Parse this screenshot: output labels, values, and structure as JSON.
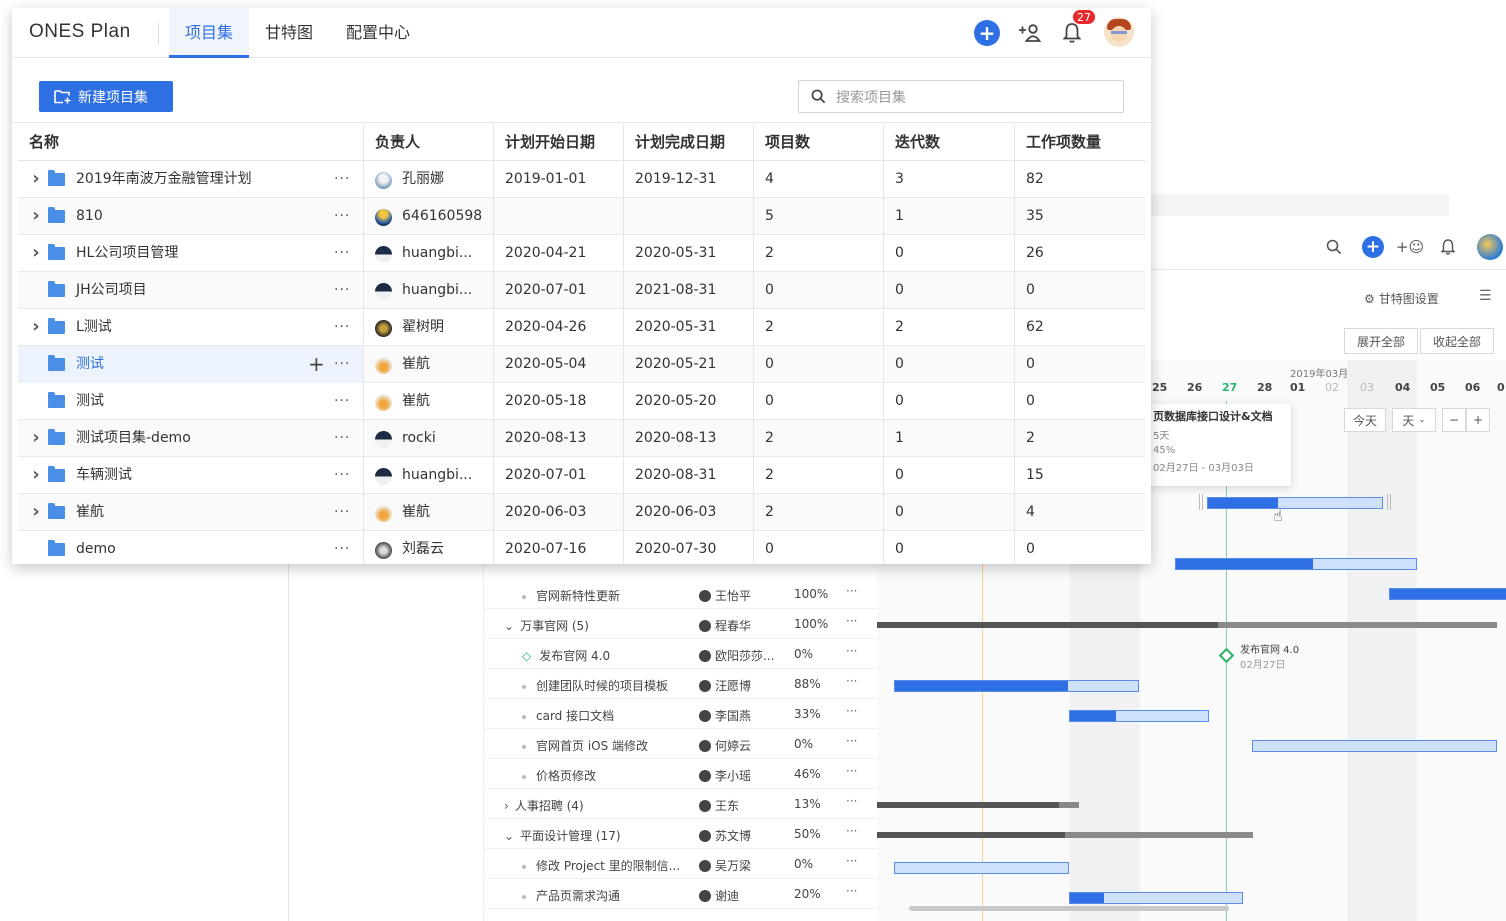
{
  "app": {
    "brand": "ONES Plan",
    "tabs": [
      {
        "label": "项目集",
        "active": true
      },
      {
        "label": "甘特图",
        "active": false
      },
      {
        "label": "配置中心",
        "active": false
      }
    ],
    "notification_count": "27",
    "accent_color": "#2f6fe4",
    "badge_color": "#e7292d"
  },
  "toolbar": {
    "new_button_label": "新建项目集",
    "search_placeholder": "搜索项目集"
  },
  "table": {
    "columns": [
      "名称",
      "负责人",
      "计划开始日期",
      "计划完成日期",
      "项目数",
      "迭代数",
      "工作项数量"
    ],
    "rows": [
      {
        "name": "2019年南波万金融管理计划",
        "owner": "孔丽娜",
        "start": "2019-01-01",
        "end": "2019-12-31",
        "projects": "4",
        "iterations": "3",
        "items": "82",
        "expandable": true
      },
      {
        "name": "810",
        "owner": "646160598",
        "start": "",
        "end": "",
        "projects": "5",
        "iterations": "1",
        "items": "35",
        "expandable": true
      },
      {
        "name": "HL公司项目管理",
        "owner": "huangbi...",
        "start": "2020-04-21",
        "end": "2020-05-31",
        "projects": "2",
        "iterations": "0",
        "items": "26",
        "expandable": true
      },
      {
        "name": "JH公司项目",
        "owner": "huangbi...",
        "start": "2020-07-01",
        "end": "2021-08-31",
        "projects": "0",
        "iterations": "0",
        "items": "0",
        "expandable": false
      },
      {
        "name": "L测试",
        "owner": "翟树明",
        "start": "2020-04-26",
        "end": "2020-05-31",
        "projects": "2",
        "iterations": "2",
        "items": "62",
        "expandable": true
      },
      {
        "name": "测试",
        "owner": "崔航",
        "start": "2020-05-04",
        "end": "2020-05-21",
        "projects": "0",
        "iterations": "0",
        "items": "0",
        "expandable": false,
        "selected": true
      },
      {
        "name": "测试",
        "owner": "崔航",
        "start": "2020-05-18",
        "end": "2020-05-20",
        "projects": "0",
        "iterations": "0",
        "items": "0",
        "expandable": false
      },
      {
        "name": "测试项目集-demo",
        "owner": "rocki",
        "start": "2020-08-13",
        "end": "2020-08-13",
        "projects": "2",
        "iterations": "1",
        "items": "2",
        "expandable": true
      },
      {
        "name": "车辆测试",
        "owner": "huangbi...",
        "start": "2020-07-01",
        "end": "2020-08-31",
        "projects": "2",
        "iterations": "0",
        "items": "15",
        "expandable": true
      },
      {
        "name": "崔航",
        "owner": "崔航",
        "start": "2020-06-03",
        "end": "2020-06-03",
        "projects": "2",
        "iterations": "0",
        "items": "4",
        "expandable": true
      },
      {
        "name": "demo",
        "owner": "刘磊云",
        "start": "2020-07-16",
        "end": "2020-07-30",
        "projects": "0",
        "iterations": "0",
        "items": "0",
        "expandable": false
      }
    ]
  },
  "background_gantt": {
    "gantt_settings_label": "甘特图设置",
    "expand_all_label": "展开全部",
    "collapse_all_label": "收起全部",
    "today_label": "今天",
    "unit_label": "天",
    "month_label": "2019年03月",
    "days": [
      "25",
      "26",
      "27",
      "28",
      "01",
      "02",
      "03",
      "04",
      "05",
      "06",
      "0"
    ],
    "tooltip": {
      "title": "页数据库接口设计&文档",
      "duration": "5天",
      "progress": "45%",
      "range": "02月27日 - 03月03日"
    },
    "milestone": {
      "name": "发布官网 4.0",
      "date": "02月27日"
    },
    "rows": [
      {
        "name": "官网新特性更新",
        "owner": "王怡平",
        "pct": "100%",
        "kind": "task"
      },
      {
        "name": "万事官网 (5)",
        "owner": "程春华",
        "pct": "100%",
        "kind": "group"
      },
      {
        "name": "发布官网 4.0",
        "owner": "欧阳莎莎...",
        "pct": "0%",
        "kind": "milestone"
      },
      {
        "name": "创建团队时候的项目模板",
        "owner": "汪愿博",
        "pct": "88%",
        "kind": "task"
      },
      {
        "name": "card 接口文档",
        "owner": "李国燕",
        "pct": "33%",
        "kind": "task"
      },
      {
        "name": "官网首页 iOS 端修改",
        "owner": "何婷云",
        "pct": "0%",
        "kind": "task"
      },
      {
        "name": "价格页修改",
        "owner": "李小瑶",
        "pct": "46%",
        "kind": "task"
      },
      {
        "name": "人事招聘 (4)",
        "owner": "王东",
        "pct": "13%",
        "kind": "group-collapsed"
      },
      {
        "name": "平面设计管理 (17)",
        "owner": "苏文博",
        "pct": "50%",
        "kind": "group"
      },
      {
        "name": "修改 Project 里的限制信...",
        "owner": "吴万梁",
        "pct": "0%",
        "kind": "task"
      },
      {
        "name": "产品页需求沟通",
        "owner": "谢迪",
        "pct": "20%",
        "kind": "task"
      }
    ],
    "ellipsis": "···"
  }
}
